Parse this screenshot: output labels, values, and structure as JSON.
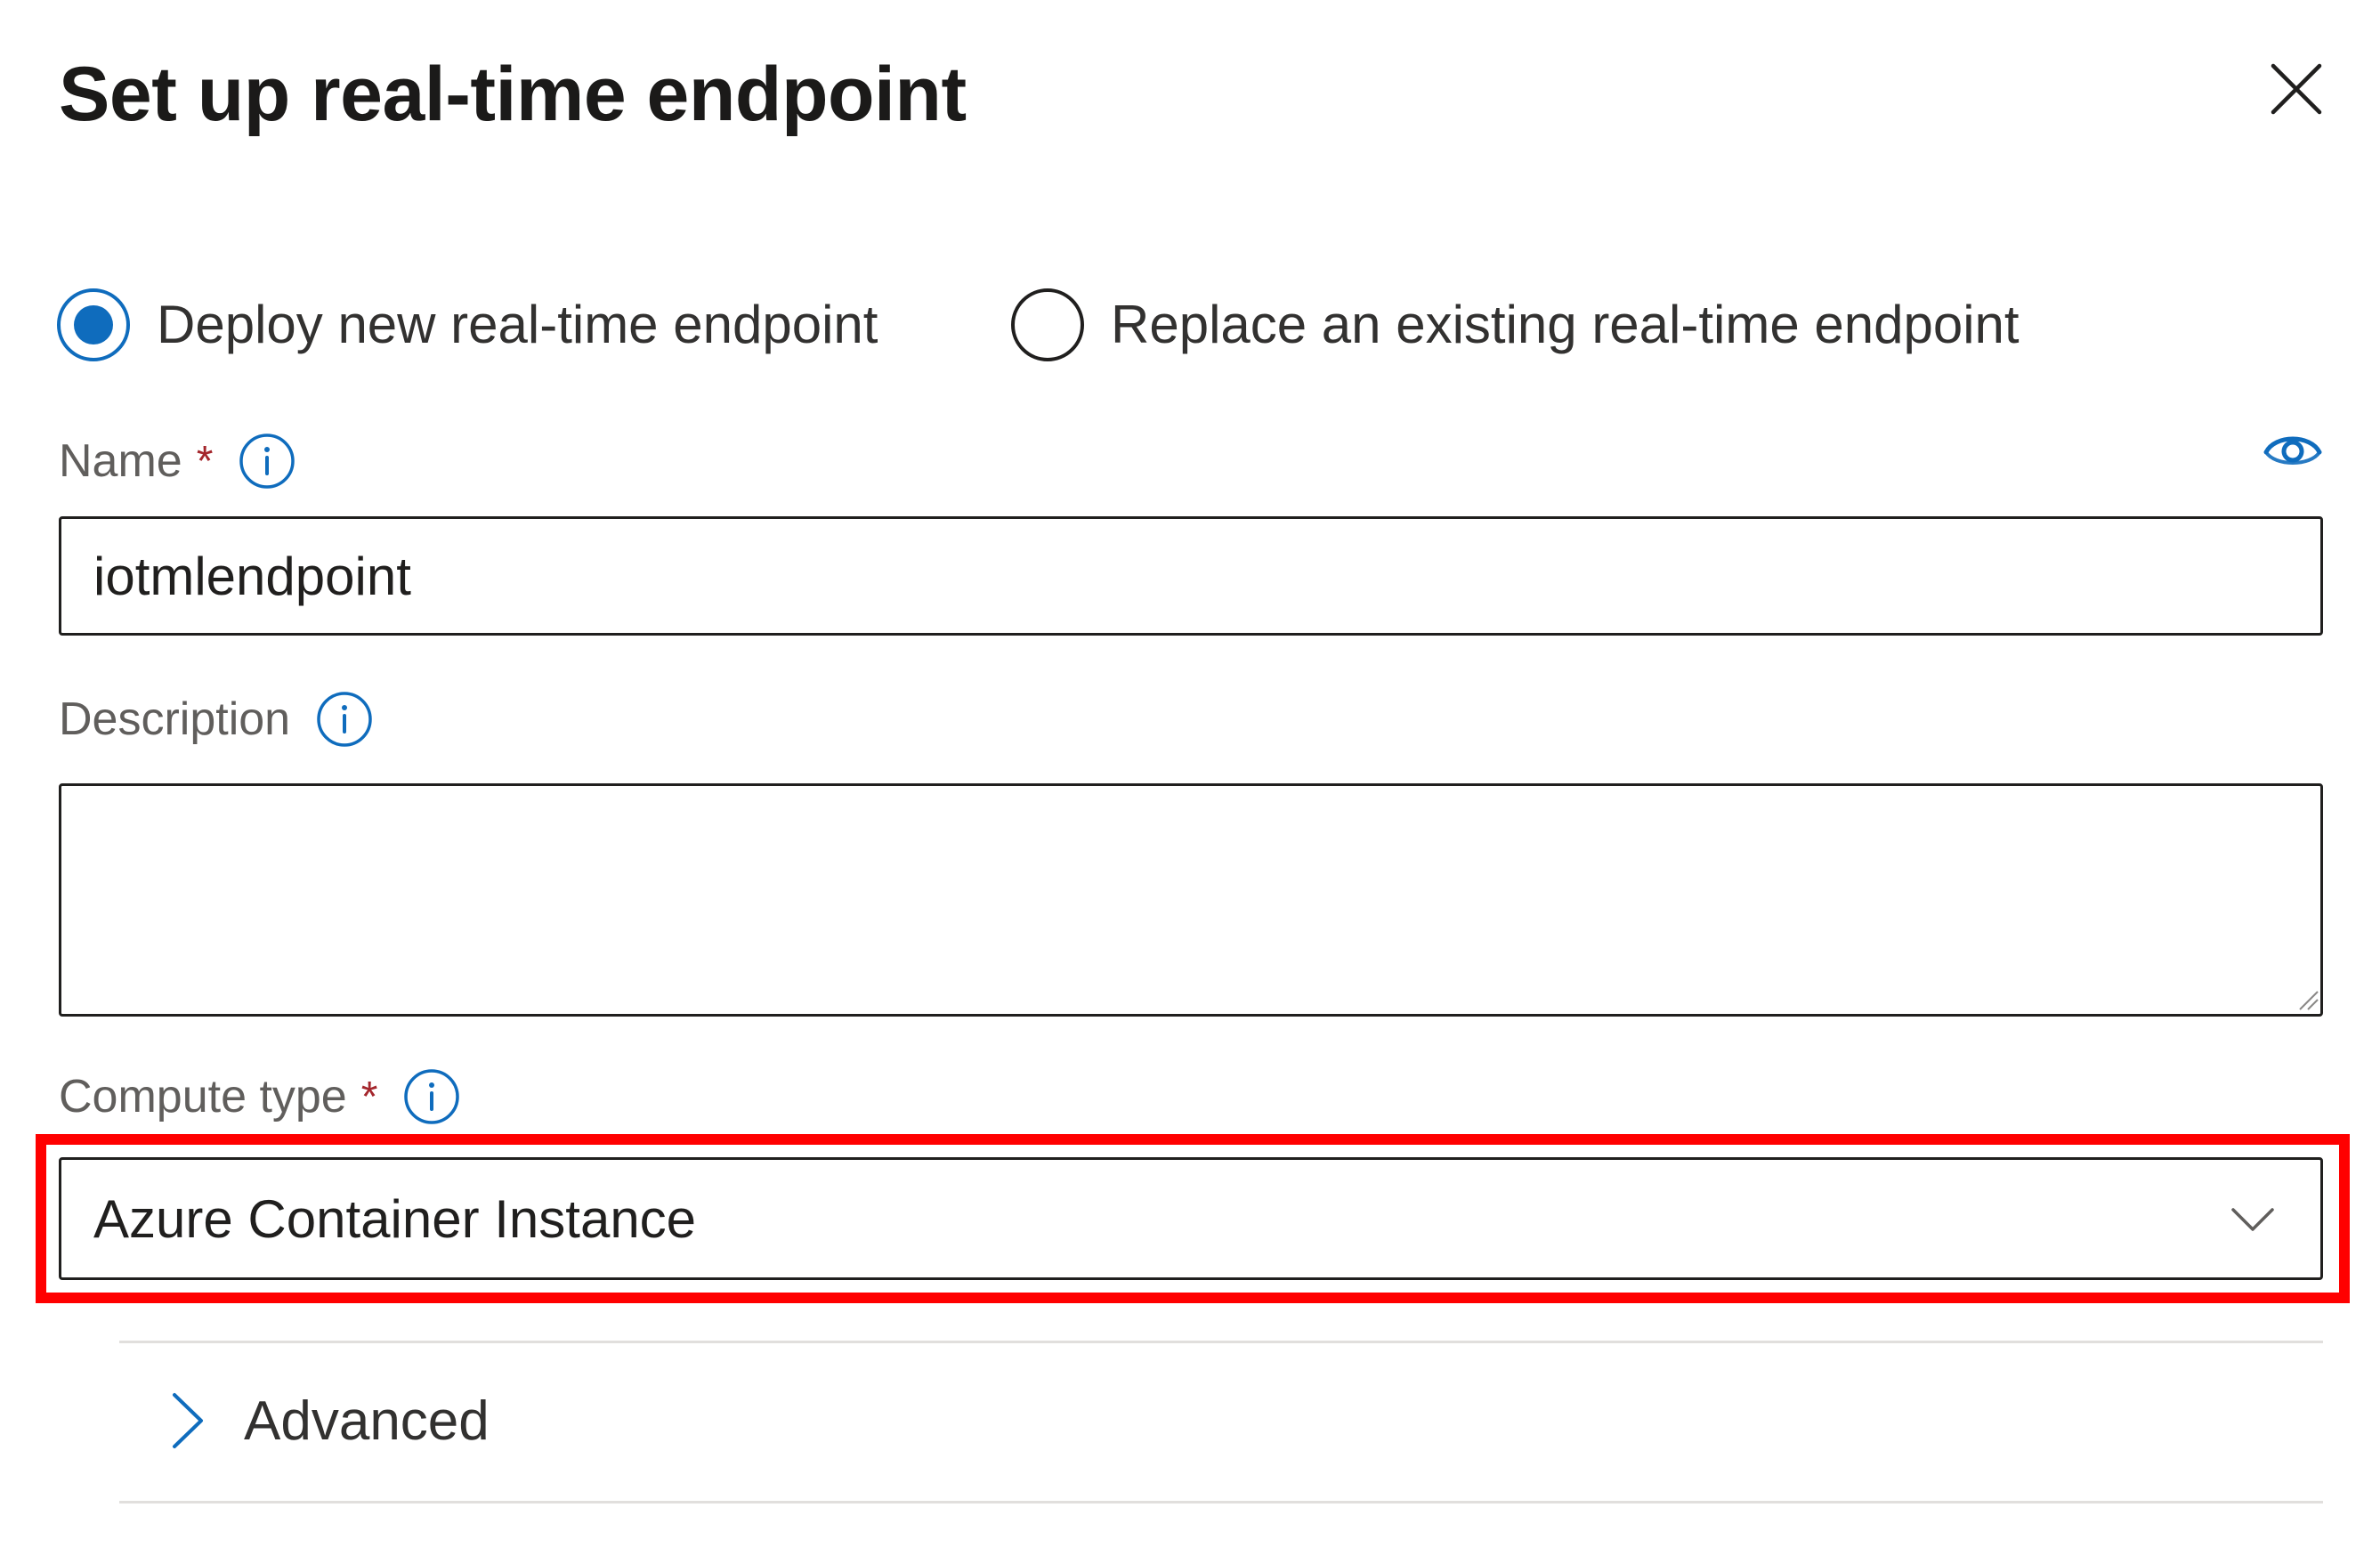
{
  "dialog": {
    "title": "Set up real-time endpoint",
    "close_icon": "close-icon"
  },
  "deployment_mode": {
    "options": [
      {
        "label": "Deploy new real-time endpoint",
        "selected": true
      },
      {
        "label": "Replace an existing real-time endpoint",
        "selected": false
      }
    ]
  },
  "name_field": {
    "label": "Name",
    "required_marker": "*",
    "value": "iotmlendpoint",
    "info_icon": "info-icon",
    "visibility_icon": "eye-icon"
  },
  "description_field": {
    "label": "Description",
    "value": "",
    "info_icon": "info-icon"
  },
  "compute_type_field": {
    "label": "Compute type",
    "required_marker": "*",
    "selected_value": "Azure Container Instance",
    "info_icon": "info-icon",
    "dropdown_icon": "chevron-down-icon"
  },
  "advanced_section": {
    "label": "Advanced",
    "expanded": false,
    "icon": "chevron-right-icon"
  },
  "colors": {
    "accent": "#0f6cbd",
    "required": "#a4262c",
    "highlight": "#ff0000",
    "text": "#201f1e",
    "label": "#605e5c",
    "divider": "#e1dfdd"
  }
}
